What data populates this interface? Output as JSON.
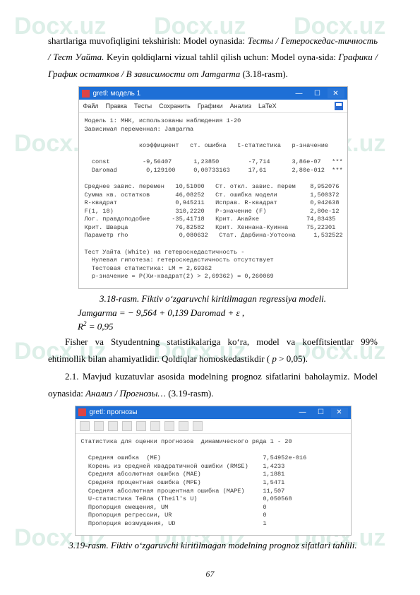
{
  "watermark": "Docx.uz",
  "paragraphs": {
    "p1_a": "shartlariga muvofiqligini tekshirish: Model oynasida: ",
    "p1_b": "Тесты / Гетероскедас-тичность / Тест Уайта.",
    "p1_c": " Keyin qoldiqlarni vizual tahlil qilish uchun: Model oyna-sida: ",
    "p1_d": "Графики / График остатков / В зависимости от Jamgarma",
    "p1_e": " (3.18-rasm).",
    "fisher": "Fisher va Styudentning statistikalariga koʻra, model va koeffitsientlar 99% ehtimollik bilan ahamiyatlidir. Qoldiqlar homoskedastikdir (",
    "fisher_p": " p",
    "fisher_tail": " > 0,05).",
    "p21": "2.1.  Mavjud  kuzatuvlar  asosida  modelning  prognoz  sifatlarini  baholaymiz. Model oynasida: ",
    "p21_it": "Анализ / Прогнозы…",
    "p21_tail": "  (3.19-rasm)."
  },
  "window1": {
    "title": "gretl: модель 1",
    "menus": [
      "Файл",
      "Правка",
      "Тесты",
      "Сохранить",
      "Графики",
      "Анализ",
      "LaTeX"
    ],
    "lines": [
      "Модель 1: МНК, использованы наблюдения 1-20",
      "Зависимая переменная: Jamgarma",
      "",
      "               коэффициент   ст. ошибка   t-статистика   p-значение",
      "",
      "  const         -9,56407      1,23850        -7,714      3,86e-07   ***",
      "  Daromad        0,129100     0,00733163     17,61       2,80e-012  ***",
      "",
      "Среднее завис. перемен   10,51000   Ст. откл. завис. перем    8,952076",
      "Сумма кв. остатков       46,08252   Ст. ошибка модели         1,500372",
      "R-квадрат                0,945211   Исправ. R-квадрат         0,942638",
      "F(1, 18)                 310,2220   P-значение (F)            2,80e-12",
      "Лог. правдоподобие      -35,41718   Крит. Акайке             74,83435",
      "Крит. Шварца             76,82582   Крит. Хеннана-Куинна     75,22301",
      "Параметр rho              0,080632   Стат. Дарбина-Уотсона     1,532522",
      "",
      "Тест Уайта (White) на гетероскедастичность -",
      "  Нулевая гипотеза: гетероскедастичность отсутствует",
      "  Тестовая статистика: LM = 2,69362",
      "  р-значение = P(Хи-квадрат(2) > 2,69362) = 0,260069"
    ]
  },
  "caption1": "3.18-rasm. Fiktiv oʻzgaruvchi kiritilmagan regressiya modeli.",
  "equations": {
    "eq1_a": "Jamgarma = − 9,564 + 0,139 Daromad + ε ,",
    "eq2": "R",
    "eq2_b": "= 0,95"
  },
  "window2": {
    "title": "gretl: прогнозы",
    "lines": [
      "Статистика для оценки прогнозов  динамического ряда 1 - 20",
      "",
      "  Средняя ошибка  (ME)                            7,54952e-016",
      "  Корень из средней квадратичной ошибки (RMSE)    1,4233",
      "  Средняя абсолютная ошибка (MAE)                 1,1881",
      "  Средняя процентная ошибка (MPE)                 1,5471",
      "  Средняя абсолютная процентная ошибка (MAPE)     11,507",
      "  U-статистика Тейла (Theil's U)                  0,050568",
      "  Пропорция смещения, UM                          0",
      "  Пропорция регрессии, UR                         0",
      "  Пропорция возмущения, UD                        1"
    ]
  },
  "caption2": "3.19-rasm. Fiktiv oʻzgaruvchi kiritilmagan modelning prognoz sifatlari tahlili.",
  "pagenum": "67"
}
